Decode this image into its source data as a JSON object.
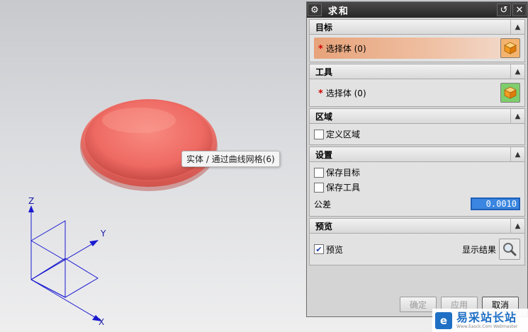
{
  "viewport": {
    "tooltip": "实体 / 通过曲线网格(6)",
    "axes": {
      "z": "Z",
      "y": "Y",
      "x": "X"
    },
    "shape_color": "#ee6a63",
    "axis_color": "#1a1ad0"
  },
  "dialog": {
    "title": "求和",
    "title_icons": [
      "gear-icon",
      "reset-icon",
      "close-icon"
    ],
    "sections": {
      "target": {
        "header": "目标",
        "select_label": "选择体 (0)"
      },
      "tool": {
        "header": "工具",
        "select_label": "选择体 (0)"
      },
      "region": {
        "header": "区域",
        "define_region": "定义区域",
        "define_region_checked": false
      },
      "settings": {
        "header": "设置",
        "keep_target": "保存目标",
        "keep_target_checked": false,
        "keep_tool": "保存工具",
        "keep_tool_checked": false,
        "tolerance_label": "公差",
        "tolerance_value": "0.0010"
      },
      "preview": {
        "header": "预览",
        "preview_label": "预览",
        "preview_checked": true,
        "show_result": "显示结果"
      }
    },
    "buttons": {
      "ok": "确定",
      "apply": "应用",
      "cancel": "取消"
    }
  },
  "watermark": {
    "text": "易采站长站",
    "sub": "Www.Easck.Com Webmaster"
  }
}
